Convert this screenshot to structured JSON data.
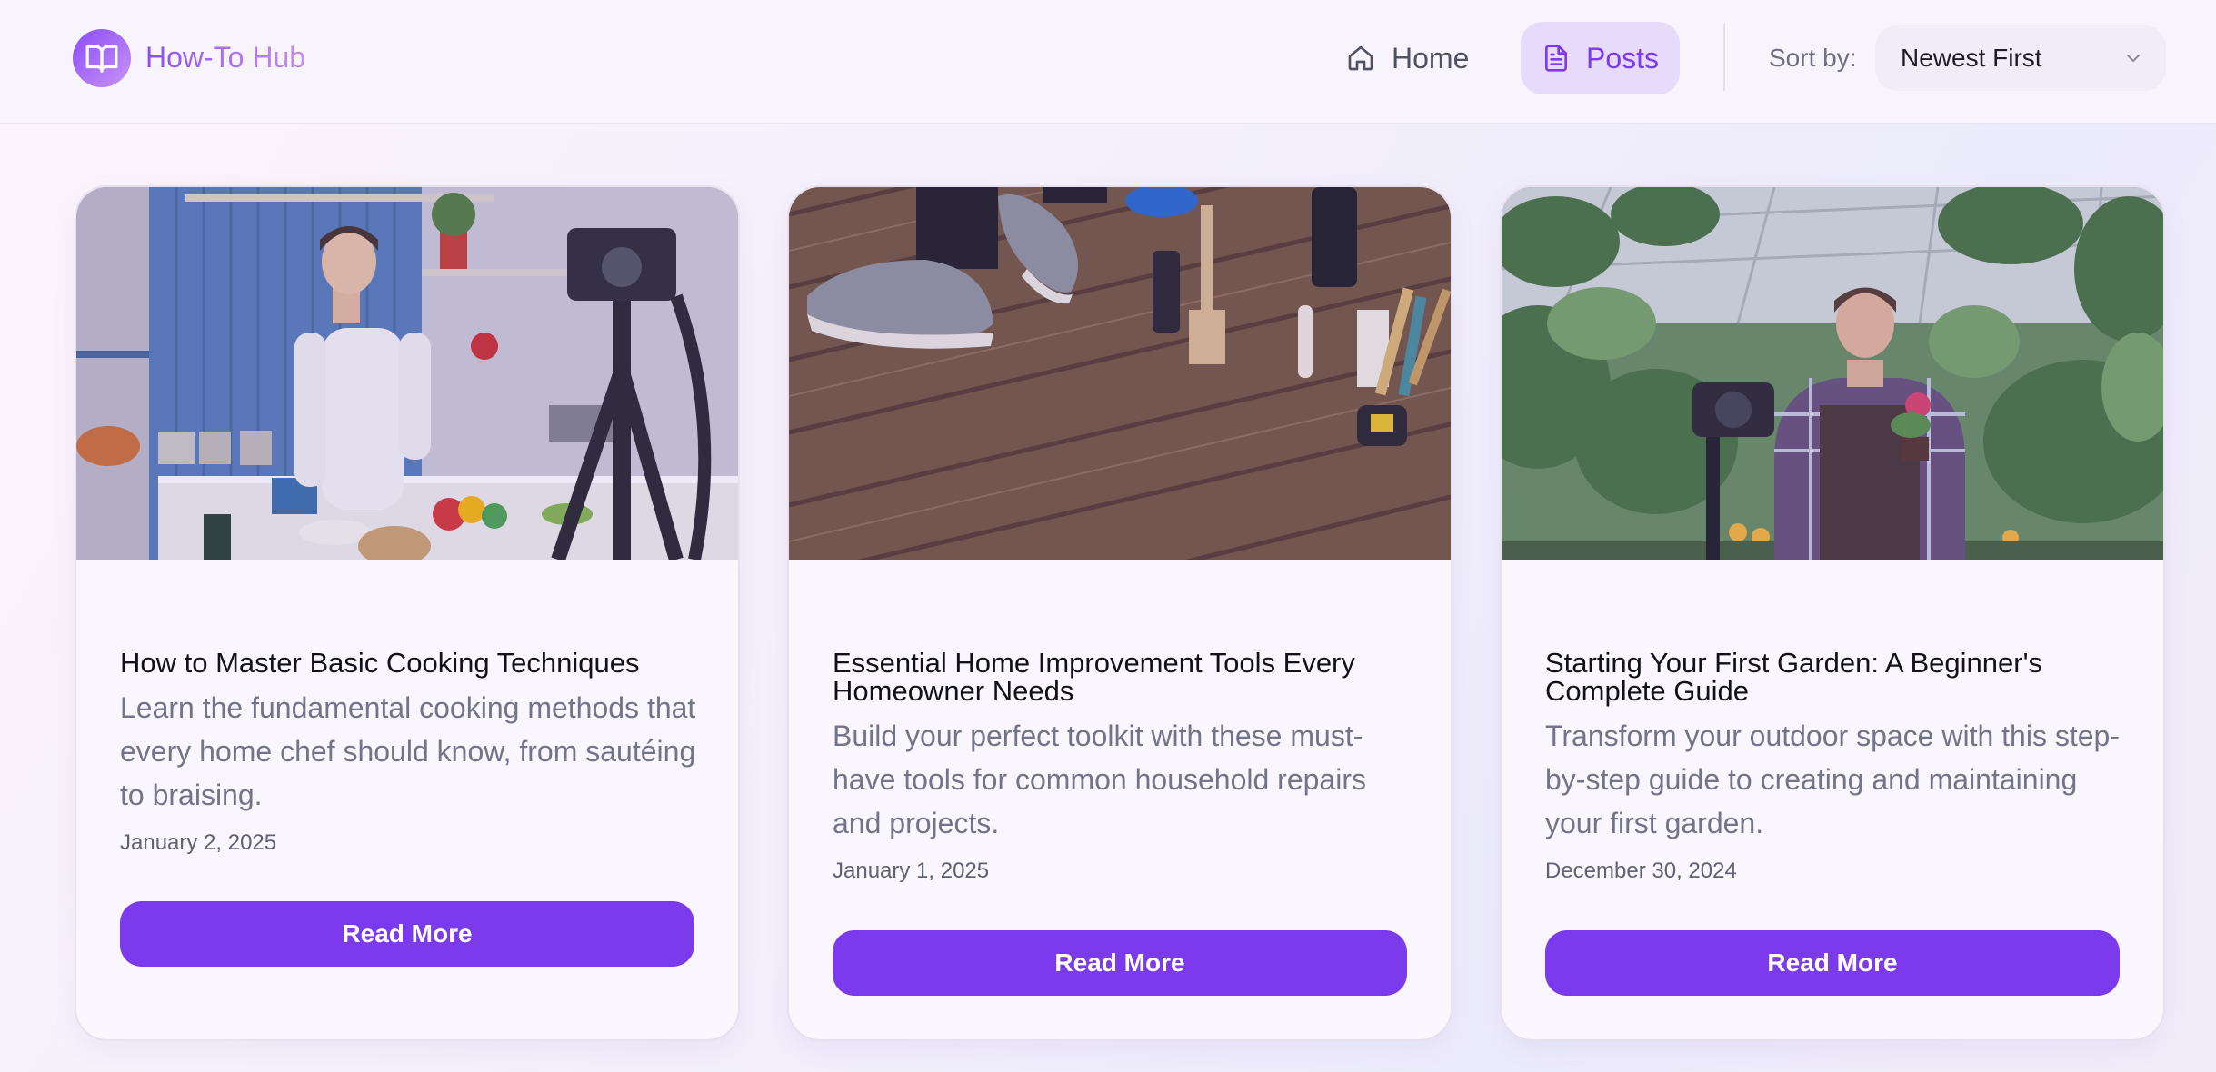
{
  "header": {
    "logo_text": "How-To Hub",
    "nav": {
      "home_label": "Home",
      "posts_label": "Posts"
    },
    "sort": {
      "label": "Sort by:",
      "selected": "Newest First"
    }
  },
  "colors": {
    "accent": "#7c3aed",
    "active_nav_bg": "#e7dbfb",
    "button_text": "#ffffff"
  },
  "icons": {
    "logo": "open-book-icon",
    "home": "home-icon",
    "posts": "document-icon",
    "sort": "chevron-down-icon"
  },
  "posts": [
    {
      "title": "How to Master Basic Cooking Techniques",
      "description": "Learn the fundamental cooking methods that every home chef should know, from sautéing to braising.",
      "date": "January 2, 2025",
      "button_label": "Read More"
    },
    {
      "title": "Essential Home Improvement Tools Every Homeowner Needs",
      "description": "Build your perfect toolkit with these must-have tools for common household repairs and projects.",
      "date": "January 1, 2025",
      "button_label": "Read More"
    },
    {
      "title": "Starting Your First Garden: A Beginner's Complete Guide",
      "description": "Transform your outdoor space with this step-by-step guide to creating and maintaining your first garden.",
      "date": "December 30, 2024",
      "button_label": "Read More"
    }
  ]
}
